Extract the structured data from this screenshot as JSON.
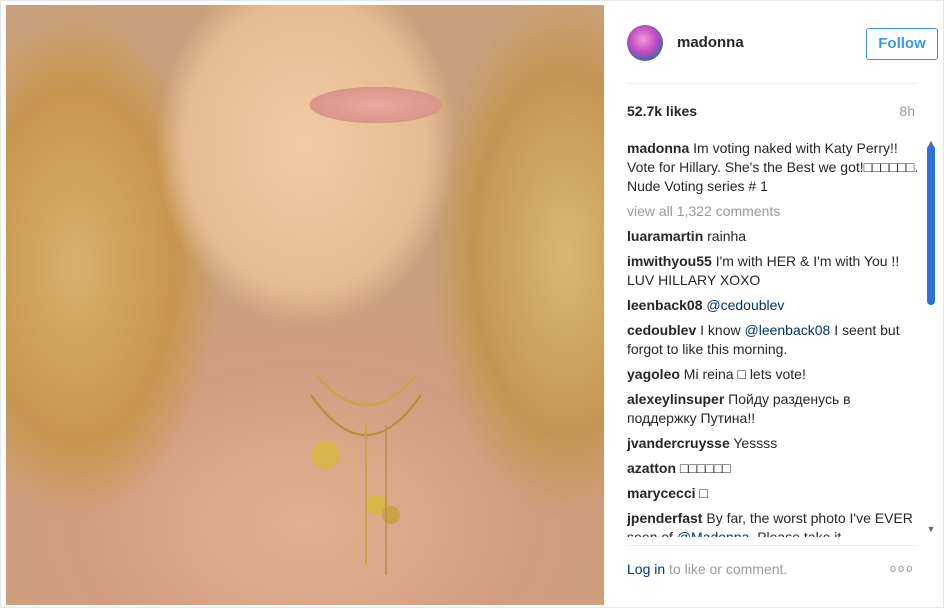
{
  "post": {
    "username": "madonna",
    "follow_label": "Follow",
    "likes": "52.7k likes",
    "time": "8h",
    "caption": {
      "user": "madonna",
      "text": "Im voting naked with Katy Perry!! Vote for Hillary. She's the Best we got!□□□□□□. Nude Voting series # 1"
    },
    "view_all": "view all 1,322 comments",
    "comments": [
      {
        "user": "luaramartin",
        "text": "rainha"
      },
      {
        "user": "imwithyou55",
        "text": "I'm with HER & I'm with You !! LUV HILLARY XOXO"
      },
      {
        "user": "leenback08",
        "text": "",
        "mention": "@cedoublev"
      },
      {
        "user": "cedoublev",
        "text_before": "I know ",
        "mention": "@leenback08",
        "text_after": " I seent but forgot to like this morning."
      },
      {
        "user": "yagoleo",
        "text": "Mi reina □ lets vote!"
      },
      {
        "user": "alexeylinsuper",
        "text": "Пойду разденусь в поддержку Путина!!"
      },
      {
        "user": "jvandercruysse",
        "text": "Yessss"
      },
      {
        "user": "azatton",
        "text": "□□□□□□"
      },
      {
        "user": "marycecci",
        "text": "□"
      },
      {
        "user": "jpenderfast",
        "text_before": "By far, the worst photo I've EVER seen of ",
        "mention": "@Madonna",
        "text_after": ". Please take it"
      }
    ],
    "footer": {
      "login": "Log in",
      "rest": " to like or comment.",
      "more": "ooo"
    }
  }
}
